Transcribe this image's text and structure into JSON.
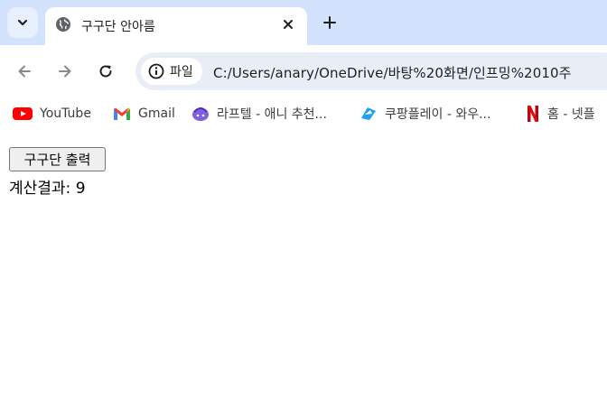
{
  "tab": {
    "title": "구구단 안아름"
  },
  "omnibox": {
    "chip_label": "파일",
    "url": "C:/Users/anary/OneDrive/바탕%20화면/인프밍%2010주"
  },
  "bookmarks": [
    {
      "label": "YouTube"
    },
    {
      "label": "Gmail"
    },
    {
      "label": "라프텔 - 애니 추천..."
    },
    {
      "label": "쿠팡플레이 - 와우..."
    },
    {
      "label": "홈 - 넷플"
    }
  ],
  "page": {
    "button_label": "구구단 출력",
    "result_text": "계산결과: 9"
  },
  "colors": {
    "tabstrip": "#d3e3fd",
    "omnibox": "#e9eef6",
    "accent": "#1a73e8"
  }
}
